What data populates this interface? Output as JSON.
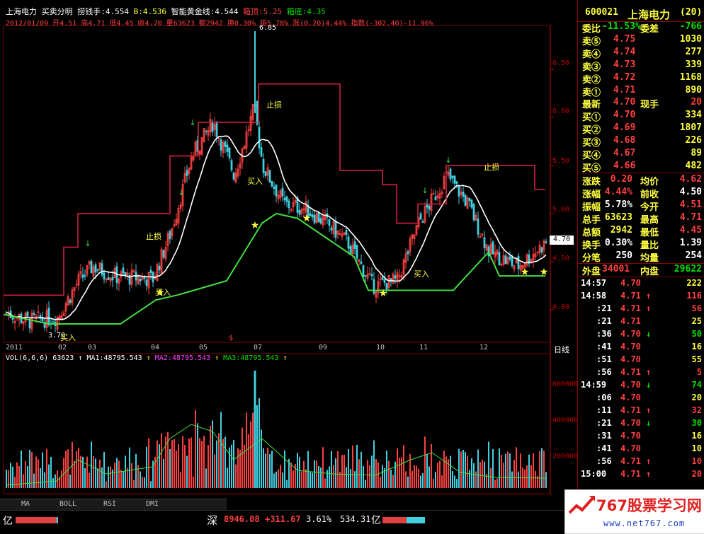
{
  "header": {
    "stock_name": "上海电力",
    "indicator": "买卖分明",
    "field1": "捞钱手:4.554",
    "field2": "B:4.536",
    "field3": "智能黄金线:4.544",
    "field4": "箱顶:5.25",
    "field5": "箱底:4.35",
    "line2": "2012/01/09  开4.51  高4.71  低4.45  收4.70  量63623  额2942  换0.30%  振5.78%  涨(0.20)4.44%  指数(-302.40)-11.96%"
  },
  "chart": {
    "ylabels": [
      "6.50",
      "6.00",
      "5.50",
      "5.00",
      "4.50",
      "4.00"
    ],
    "current_price_tag": "4.70",
    "peak_label": "6.85",
    "low_label": "3.70",
    "annotations": [
      "止损",
      "止损",
      "止损",
      "买入",
      "买入",
      "买入",
      "买入"
    ],
    "xlabels": [
      "2011",
      "02",
      "03",
      "04",
      "05",
      "07",
      "09",
      "10",
      "11",
      "12"
    ],
    "period": "日线",
    "vol_header": "VOL(6,6,6)  63623",
    "ma1": "MA1:48795.543",
    "ma2": "MA2:48795.543",
    "ma3": "MA3:48795.543",
    "vol_ylabels": [
      "600000",
      "400000",
      "200000"
    ]
  },
  "chart_data": {
    "type": "line",
    "title": "上海电力",
    "x": [
      "2011",
      "02",
      "03",
      "04",
      "05",
      "07",
      "09",
      "10",
      "11",
      "12"
    ],
    "series": [
      {
        "name": "收",
        "values": [
          3.9,
          4.0,
          4.4,
          4.35,
          5.8,
          5.9,
          4.9,
          4.3,
          5.3,
          4.7
        ]
      }
    ],
    "ylim": [
      3.6,
      6.9
    ]
  },
  "side": {
    "code": "600021",
    "name": "上海电力",
    "count": "(20)",
    "weibi_label": "委比",
    "weibi": "-11.53%",
    "weicha_label": "委差",
    "weicha": "-766",
    "sells": [
      {
        "label": "卖⑤",
        "price": "4.75",
        "vol": "1030"
      },
      {
        "label": "卖④",
        "price": "4.74",
        "vol": "277"
      },
      {
        "label": "卖③",
        "price": "4.73",
        "vol": "339"
      },
      {
        "label": "卖②",
        "price": "4.72",
        "vol": "1168"
      },
      {
        "label": "卖①",
        "price": "4.71",
        "vol": "890"
      }
    ],
    "latest_label": "最新",
    "latest": "4.70",
    "xianshou_label": "现手",
    "xianshou": "20",
    "buys": [
      {
        "label": "买①",
        "price": "4.70",
        "vol": "334"
      },
      {
        "label": "买②",
        "price": "4.69",
        "vol": "1807"
      },
      {
        "label": "买③",
        "price": "4.68",
        "vol": "226"
      },
      {
        "label": "买④",
        "price": "4.67",
        "vol": "89"
      },
      {
        "label": "买⑤",
        "price": "4.66",
        "vol": "482"
      }
    ],
    "stats": [
      {
        "l1": "涨跌",
        "v1": "0.20",
        "l2": "均价",
        "v2": "4.62"
      },
      {
        "l1": "涨幅",
        "v1": "4.44%",
        "l2": "前收",
        "v2": "4.50"
      },
      {
        "l1": "振幅",
        "v1": "5.78%",
        "l2": "今开",
        "v2": "4.51"
      },
      {
        "l1": "总手",
        "v1": "63623",
        "l2": "最高",
        "v2": "4.71"
      },
      {
        "l1": "总额",
        "v1": "2942",
        "l2": "最低",
        "v2": "4.45"
      },
      {
        "l1": "换手",
        "v1": "0.30%",
        "l2": "量比",
        "v2": "1.39"
      },
      {
        "l1": "分笔",
        "v1": "250",
        "l2": "均量",
        "v2": "254"
      }
    ],
    "waipan_label": "外盘",
    "waipan": "34001",
    "neipan_label": "内盘",
    "neipan": "29622",
    "ticks": [
      {
        "time": "14:57",
        "price": "4.70",
        "dir": "",
        "vol": "222"
      },
      {
        "time": "14:58",
        "price": "4.71",
        "dir": "↑",
        "vol": "116"
      },
      {
        "time": ":21",
        "price": "4.71",
        "dir": "↑",
        "vol": "56"
      },
      {
        "time": ":21",
        "price": "4.71",
        "dir": "",
        "vol": "25"
      },
      {
        "time": ":36",
        "price": "4.70",
        "dir": "↓",
        "vol": "50"
      },
      {
        "time": ":41",
        "price": "4.70",
        "dir": "",
        "vol": "16"
      },
      {
        "time": ":51",
        "price": "4.70",
        "dir": "",
        "vol": "55"
      },
      {
        "time": ":56",
        "price": "4.71",
        "dir": "↑",
        "vol": "5"
      },
      {
        "time": "14:59",
        "price": "4.70",
        "dir": "↓",
        "vol": "74"
      },
      {
        "time": ":06",
        "price": "4.70",
        "dir": "",
        "vol": "20"
      },
      {
        "time": ":11",
        "price": "4.71",
        "dir": "↑",
        "vol": "32"
      },
      {
        "time": ":21",
        "price": "4.70",
        "dir": "↓",
        "vol": "30"
      },
      {
        "time": ":31",
        "price": "4.70",
        "dir": "",
        "vol": "16"
      },
      {
        "time": ":41",
        "price": "4.70",
        "dir": "",
        "vol": "10"
      },
      {
        "time": ":56",
        "price": "4.71",
        "dir": "↑",
        "vol": "10"
      },
      {
        "time": "15:00",
        "price": "4.71",
        "dir": "↑",
        "vol": "20"
      }
    ]
  },
  "tabs": [
    "MA",
    "BOLL",
    "RSI",
    "DMI"
  ],
  "status": {
    "left_unit": "亿",
    "market": "深",
    "index_value": "8946.08",
    "index_change": "+311.67",
    "index_pct": "3.61%",
    "amount": "534.31",
    "right_unit": "亿"
  },
  "logo": {
    "brand": "767股票学习网",
    "url": "www.net767.com"
  },
  "colors": {
    "up": "#ff4040",
    "down": "#00e000",
    "stoploss": "#d02040",
    "support": "#40e040",
    "vol_cyan": "#40d0e0"
  }
}
